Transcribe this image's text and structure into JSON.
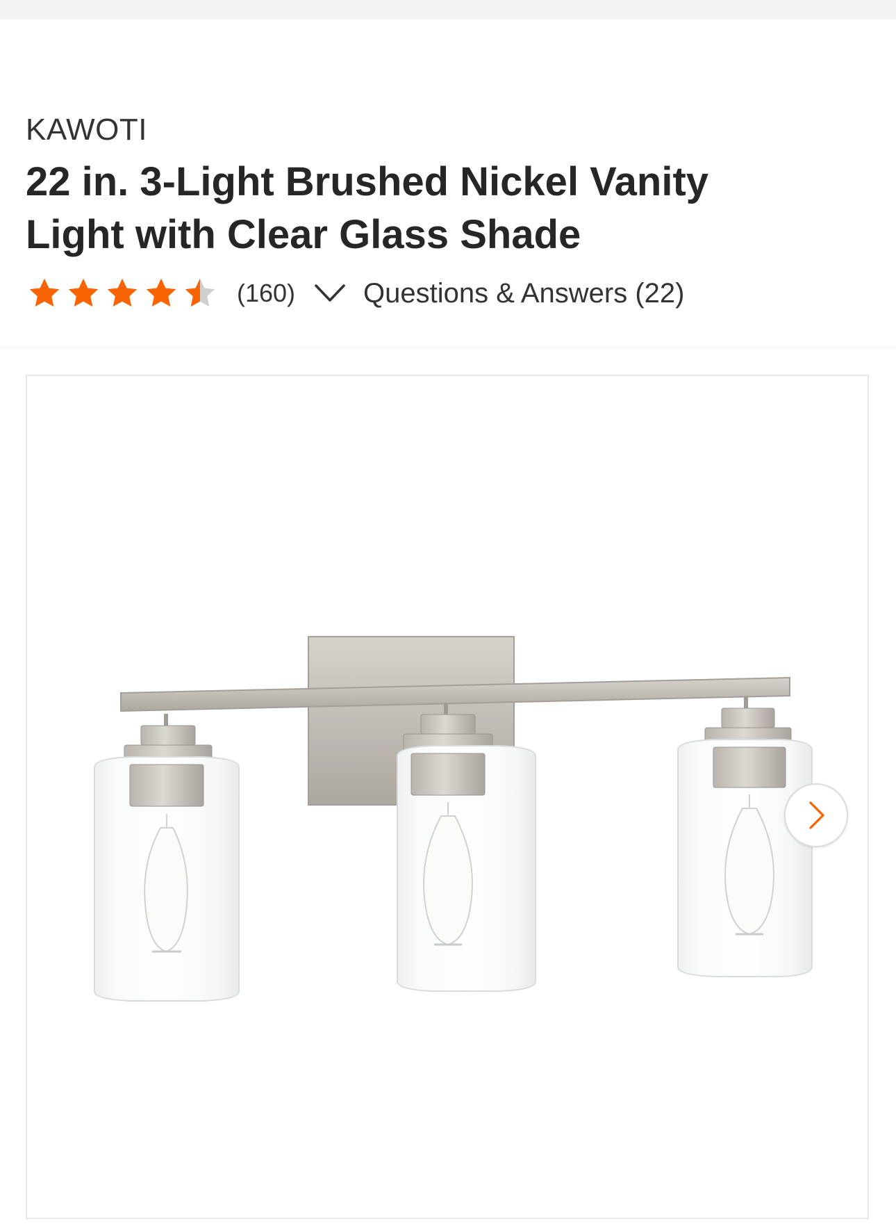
{
  "product": {
    "brand": "KAWOTI",
    "title": "22 in. 3-Light Brushed Nickel Vanity Light with Clear Glass Shade",
    "rating": 4.5,
    "rating_max": 5,
    "review_count": "(160)",
    "qa_link": "Questions & Answers (22)"
  },
  "colors": {
    "star_filled": "#f96302",
    "star_empty": "#cfcfcf",
    "accent": "#f96302",
    "text": "#333333"
  },
  "icons": {
    "expand_reviews": "chevron-down-icon",
    "next_image": "chevron-right-icon"
  }
}
